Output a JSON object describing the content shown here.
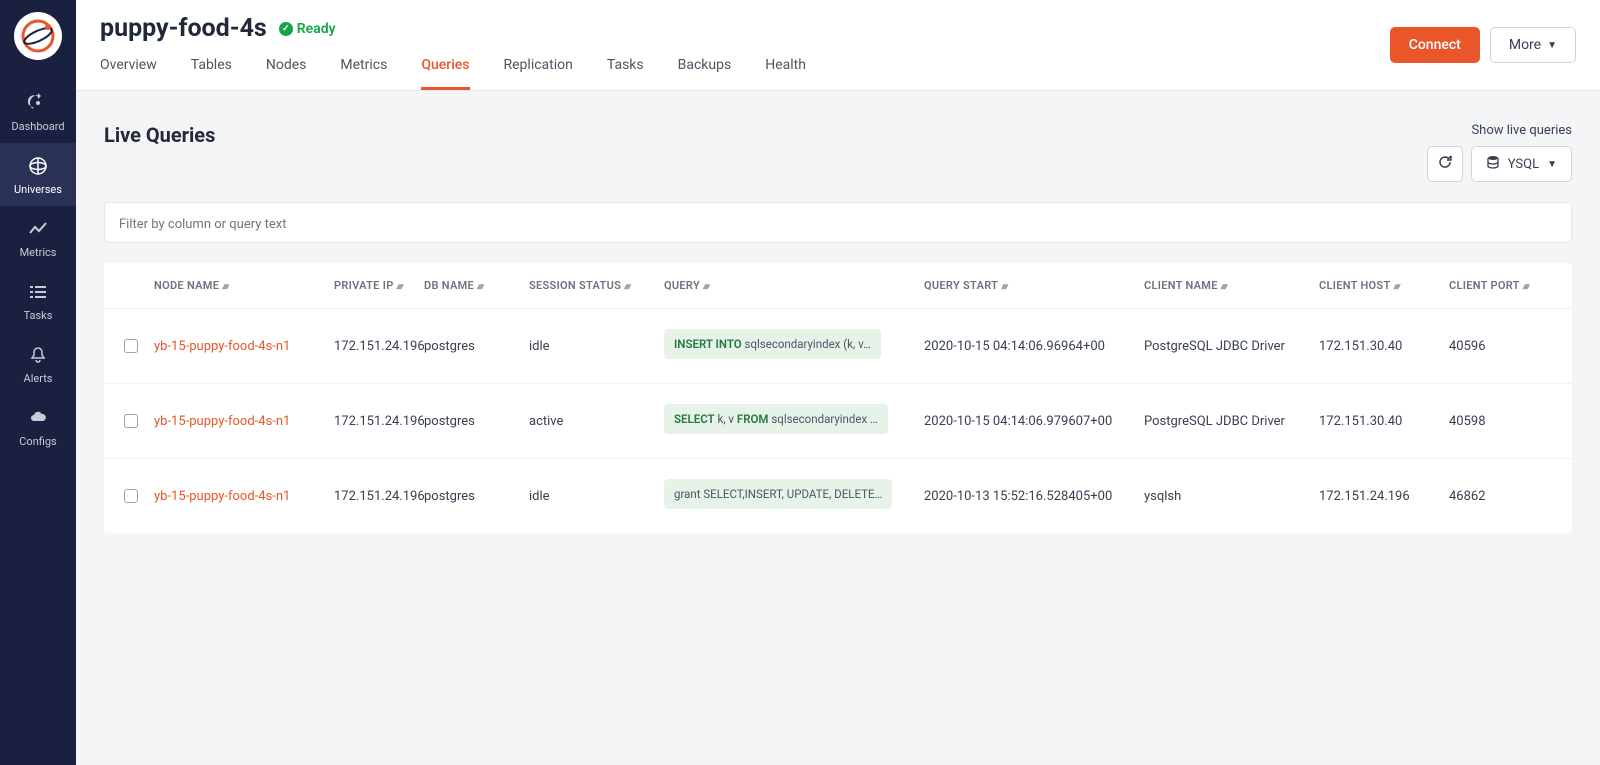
{
  "sidebar": {
    "items": [
      {
        "label": "Dashboard",
        "active": false
      },
      {
        "label": "Universes",
        "active": true
      },
      {
        "label": "Metrics",
        "active": false
      },
      {
        "label": "Tasks",
        "active": false
      },
      {
        "label": "Alerts",
        "active": false
      },
      {
        "label": "Configs",
        "active": false
      }
    ]
  },
  "header": {
    "title": "puppy-food-4s",
    "status": "Ready",
    "connect_label": "Connect",
    "more_label": "More"
  },
  "tabs": [
    {
      "label": "Overview"
    },
    {
      "label": "Tables"
    },
    {
      "label": "Nodes"
    },
    {
      "label": "Metrics"
    },
    {
      "label": "Queries",
      "active": true
    },
    {
      "label": "Replication"
    },
    {
      "label": "Tasks"
    },
    {
      "label": "Backups"
    },
    {
      "label": "Health"
    }
  ],
  "page": {
    "title": "Live Queries",
    "show_label": "Show live queries",
    "query_type": "YSQL",
    "filter_placeholder": "Filter by column or query text"
  },
  "columns": {
    "node": "NODE NAME",
    "ip": "PRIVATE IP",
    "db": "DB NAME",
    "session": "SESSION STATUS",
    "query": "QUERY",
    "start": "QUERY START",
    "client": "CLIENT NAME",
    "host": "CLIENT HOST",
    "port": "CLIENT PORT"
  },
  "rows": [
    {
      "node": "yb-15-puppy-food-4s-n1",
      "ip": "172.151.24.196",
      "db": "postgres",
      "session": "idle",
      "query_kw": "INSERT INTO",
      "query_rest": " sqlsecondaryindex (k, v…",
      "start": "2020-10-15 04:14:06.96964+00",
      "client": "PostgreSQL JDBC Driver",
      "host": "172.151.30.40",
      "port": "40596"
    },
    {
      "node": "yb-15-puppy-food-4s-n1",
      "ip": "172.151.24.196",
      "db": "postgres",
      "session": "active",
      "query_kw": "SELECT",
      "query_mid": " k, v ",
      "query_kw2": "FROM",
      "query_rest": " sqlsecondaryindex …",
      "start": "2020-10-15 04:14:06.979607+00",
      "client": "PostgreSQL JDBC Driver",
      "host": "172.151.30.40",
      "port": "40598"
    },
    {
      "node": "yb-15-puppy-food-4s-n1",
      "ip": "172.151.24.196",
      "db": "postgres",
      "session": "idle",
      "query_kw": "",
      "query_rest": "grant SELECT,INSERT, UPDATE, DELETE…",
      "start": "2020-10-13 15:52:16.528405+00",
      "client": "ysqlsh",
      "host": "172.151.24.196",
      "port": "46862"
    }
  ]
}
